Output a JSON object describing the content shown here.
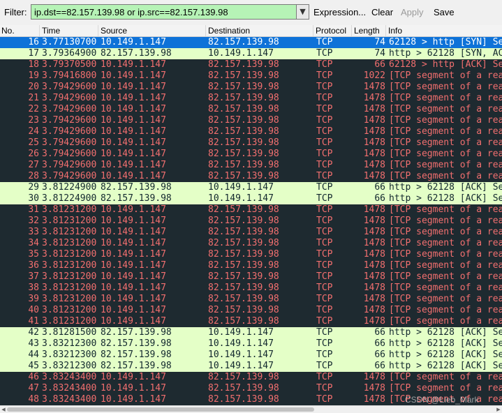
{
  "toolbar": {
    "filter_label": "Filter:",
    "filter_value": "ip.dst==82.157.139.98 or ip.src==82.157.139.98",
    "dropdown_icon": "chevron-down-icon",
    "expression_label": "Expression...",
    "clear_label": "Clear",
    "apply_label": "Apply",
    "save_label": "Save"
  },
  "columns": [
    "No.",
    "Time",
    "Source",
    "Destination",
    "Protocol",
    "Length",
    "Info"
  ],
  "colors": {
    "selected_bg": "#0e72d8",
    "tcp_dark_bg": "#1e2a30",
    "tcp_dark_fg": "#f26f6f",
    "tcp_light_bg": "#e4ffc7",
    "filter_valid_bg": "#b6f3b6"
  },
  "packets": [
    {
      "no": "16",
      "time": "3.77130700",
      "src": "10.149.1.147",
      "dst": "82.157.139.98",
      "proto": "TCP",
      "len": "74",
      "info": "62128 > http [SYN] Seq",
      "style": "selected"
    },
    {
      "no": "17",
      "time": "3.79364900",
      "src": "82.157.139.98",
      "dst": "10.149.1.147",
      "proto": "TCP",
      "len": "74",
      "info": "http > 62128 [SYN, ACK",
      "style": "tcp-light"
    },
    {
      "no": "18",
      "time": "3.79370500",
      "src": "10.149.1.147",
      "dst": "82.157.139.98",
      "proto": "TCP",
      "len": "66",
      "info": "62128 > http [ACK] Seq",
      "style": "tcp-dark"
    },
    {
      "no": "19",
      "time": "3.79416800",
      "src": "10.149.1.147",
      "dst": "82.157.139.98",
      "proto": "TCP",
      "len": "1022",
      "info": "[TCP segment of a reas",
      "style": "tcp-dark"
    },
    {
      "no": "20",
      "time": "3.79429600",
      "src": "10.149.1.147",
      "dst": "82.157.139.98",
      "proto": "TCP",
      "len": "1478",
      "info": "[TCP segment of a reas",
      "style": "tcp-dark"
    },
    {
      "no": "21",
      "time": "3.79429600",
      "src": "10.149.1.147",
      "dst": "82.157.139.98",
      "proto": "TCP",
      "len": "1478",
      "info": "[TCP segment of a reas",
      "style": "tcp-dark"
    },
    {
      "no": "22",
      "time": "3.79429600",
      "src": "10.149.1.147",
      "dst": "82.157.139.98",
      "proto": "TCP",
      "len": "1478",
      "info": "[TCP segment of a reas",
      "style": "tcp-dark"
    },
    {
      "no": "23",
      "time": "3.79429600",
      "src": "10.149.1.147",
      "dst": "82.157.139.98",
      "proto": "TCP",
      "len": "1478",
      "info": "[TCP segment of a reas",
      "style": "tcp-dark"
    },
    {
      "no": "24",
      "time": "3.79429600",
      "src": "10.149.1.147",
      "dst": "82.157.139.98",
      "proto": "TCP",
      "len": "1478",
      "info": "[TCP segment of a reas",
      "style": "tcp-dark"
    },
    {
      "no": "25",
      "time": "3.79429600",
      "src": "10.149.1.147",
      "dst": "82.157.139.98",
      "proto": "TCP",
      "len": "1478",
      "info": "[TCP segment of a reas",
      "style": "tcp-dark"
    },
    {
      "no": "26",
      "time": "3.79429600",
      "src": "10.149.1.147",
      "dst": "82.157.139.98",
      "proto": "TCP",
      "len": "1478",
      "info": "[TCP segment of a reas",
      "style": "tcp-dark"
    },
    {
      "no": "27",
      "time": "3.79429600",
      "src": "10.149.1.147",
      "dst": "82.157.139.98",
      "proto": "TCP",
      "len": "1478",
      "info": "[TCP segment of a reas",
      "style": "tcp-dark"
    },
    {
      "no": "28",
      "time": "3.79429600",
      "src": "10.149.1.147",
      "dst": "82.157.139.98",
      "proto": "TCP",
      "len": "1478",
      "info": "[TCP segment of a reas",
      "style": "tcp-dark"
    },
    {
      "no": "29",
      "time": "3.81224900",
      "src": "82.157.139.98",
      "dst": "10.149.1.147",
      "proto": "TCP",
      "len": "66",
      "info": "http > 62128 [ACK] Seq",
      "style": "tcp-light"
    },
    {
      "no": "30",
      "time": "3.81224900",
      "src": "82.157.139.98",
      "dst": "10.149.1.147",
      "proto": "TCP",
      "len": "66",
      "info": "http > 62128 [ACK] Seq",
      "style": "tcp-light"
    },
    {
      "no": "31",
      "time": "3.81231200",
      "src": "10.149.1.147",
      "dst": "82.157.139.98",
      "proto": "TCP",
      "len": "1478",
      "info": "[TCP segment of a reas",
      "style": "tcp-dark"
    },
    {
      "no": "32",
      "time": "3.81231200",
      "src": "10.149.1.147",
      "dst": "82.157.139.98",
      "proto": "TCP",
      "len": "1478",
      "info": "[TCP segment of a reas",
      "style": "tcp-dark"
    },
    {
      "no": "33",
      "time": "3.81231200",
      "src": "10.149.1.147",
      "dst": "82.157.139.98",
      "proto": "TCP",
      "len": "1478",
      "info": "[TCP segment of a reas",
      "style": "tcp-dark"
    },
    {
      "no": "34",
      "time": "3.81231200",
      "src": "10.149.1.147",
      "dst": "82.157.139.98",
      "proto": "TCP",
      "len": "1478",
      "info": "[TCP segment of a reas",
      "style": "tcp-dark"
    },
    {
      "no": "35",
      "time": "3.81231200",
      "src": "10.149.1.147",
      "dst": "82.157.139.98",
      "proto": "TCP",
      "len": "1478",
      "info": "[TCP segment of a reas",
      "style": "tcp-dark"
    },
    {
      "no": "36",
      "time": "3.81231200",
      "src": "10.149.1.147",
      "dst": "82.157.139.98",
      "proto": "TCP",
      "len": "1478",
      "info": "[TCP segment of a reas",
      "style": "tcp-dark"
    },
    {
      "no": "37",
      "time": "3.81231200",
      "src": "10.149.1.147",
      "dst": "82.157.139.98",
      "proto": "TCP",
      "len": "1478",
      "info": "[TCP segment of a reas",
      "style": "tcp-dark"
    },
    {
      "no": "38",
      "time": "3.81231200",
      "src": "10.149.1.147",
      "dst": "82.157.139.98",
      "proto": "TCP",
      "len": "1478",
      "info": "[TCP segment of a reas",
      "style": "tcp-dark"
    },
    {
      "no": "39",
      "time": "3.81231200",
      "src": "10.149.1.147",
      "dst": "82.157.139.98",
      "proto": "TCP",
      "len": "1478",
      "info": "[TCP segment of a reas",
      "style": "tcp-dark"
    },
    {
      "no": "40",
      "time": "3.81231200",
      "src": "10.149.1.147",
      "dst": "82.157.139.98",
      "proto": "TCP",
      "len": "1478",
      "info": "[TCP segment of a reas",
      "style": "tcp-dark"
    },
    {
      "no": "41",
      "time": "3.81231200",
      "src": "10.149.1.147",
      "dst": "82.157.139.98",
      "proto": "TCP",
      "len": "1478",
      "info": "[TCP segment of a reas",
      "style": "tcp-dark"
    },
    {
      "no": "42",
      "time": "3.81281500",
      "src": "82.157.139.98",
      "dst": "10.149.1.147",
      "proto": "TCP",
      "len": "66",
      "info": "http > 62128 [ACK] Seq",
      "style": "tcp-light"
    },
    {
      "no": "43",
      "time": "3.83212300",
      "src": "82.157.139.98",
      "dst": "10.149.1.147",
      "proto": "TCP",
      "len": "66",
      "info": "http > 62128 [ACK] Seq",
      "style": "tcp-light"
    },
    {
      "no": "44",
      "time": "3.83212300",
      "src": "82.157.139.98",
      "dst": "10.149.1.147",
      "proto": "TCP",
      "len": "66",
      "info": "http > 62128 [ACK] Seq",
      "style": "tcp-light"
    },
    {
      "no": "45",
      "time": "3.83212300",
      "src": "82.157.139.98",
      "dst": "10.149.1.147",
      "proto": "TCP",
      "len": "66",
      "info": "http > 62128 [ACK] Seq",
      "style": "tcp-light"
    },
    {
      "no": "46",
      "time": "3.83243400",
      "src": "10.149.1.147",
      "dst": "82.157.139.98",
      "proto": "TCP",
      "len": "1478",
      "info": "[TCP segment of a reas",
      "style": "tcp-dark"
    },
    {
      "no": "47",
      "time": "3.83243400",
      "src": "10.149.1.147",
      "dst": "82.157.139.98",
      "proto": "TCP",
      "len": "1478",
      "info": "[TCP segment of a reas",
      "style": "tcp-dark"
    },
    {
      "no": "48",
      "time": "3.83243400",
      "src": "10.149.1.147",
      "dst": "82.157.139.98",
      "proto": "TCP",
      "len": "1478",
      "info": "[TCP segment of a reas",
      "style": "tcp-dark"
    }
  ],
  "scrollbar": {
    "left_icon": "arrow-left-icon",
    "right_icon": "arrow-right-icon"
  },
  "watermark": "CSDN @Lieb_Mark"
}
